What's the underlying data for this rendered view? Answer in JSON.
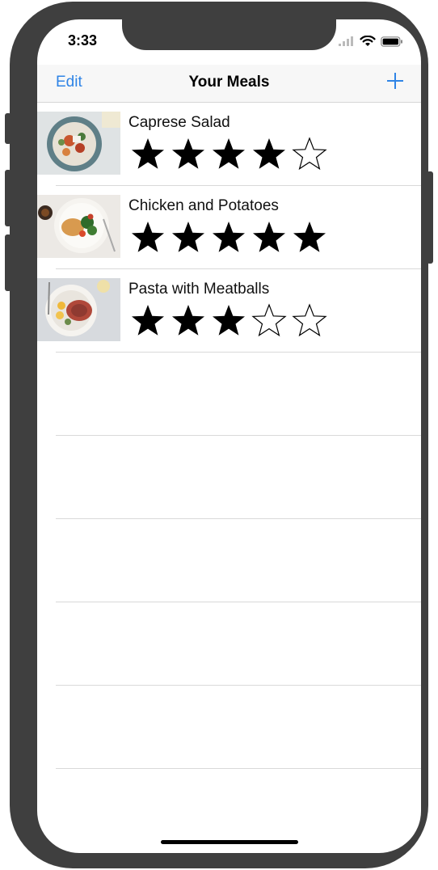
{
  "status_bar": {
    "time": "3:33",
    "icons": [
      "signal-icon",
      "wifi-icon",
      "battery-icon"
    ]
  },
  "nav_bar": {
    "edit_label": "Edit",
    "title": "Your Meals",
    "add_icon": "plus-icon",
    "accent_color": "#2f84e6"
  },
  "meals": [
    {
      "name": "Caprese Salad",
      "rating": 4,
      "max_rating": 5
    },
    {
      "name": "Chicken and Potatoes",
      "rating": 5,
      "max_rating": 5
    },
    {
      "name": "Pasta with Meatballs",
      "rating": 3,
      "max_rating": 5
    }
  ],
  "empty_rows": 6
}
